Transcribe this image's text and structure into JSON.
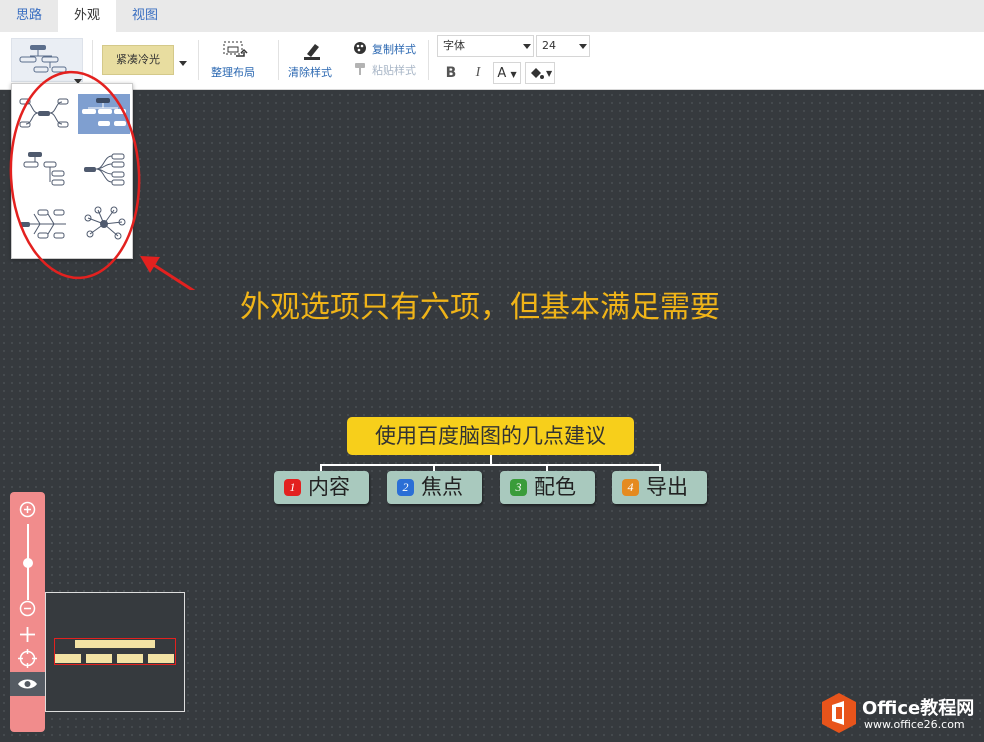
{
  "tabs": [
    {
      "label": "思路",
      "active": false
    },
    {
      "label": "外观",
      "active": true
    },
    {
      "label": "视图",
      "active": false
    }
  ],
  "toolbar": {
    "theme_label": "紧凑冷光",
    "arrange_label": "整理布局",
    "clear_style_label": "清除样式",
    "copy_style_label": "复制样式",
    "paste_style_label": "粘贴样式",
    "font_select": "字体",
    "size_select": "24",
    "bold": "B",
    "italic": "I",
    "font_color": "A",
    "bg_color_icon": "paint-bucket-icon"
  },
  "layout_options": [
    {
      "name": "mindmap",
      "selected": false
    },
    {
      "name": "org-chart",
      "selected": true
    },
    {
      "name": "tree-right",
      "selected": false
    },
    {
      "name": "fishbone-left",
      "selected": false
    },
    {
      "name": "fishbone",
      "selected": false
    },
    {
      "name": "network",
      "selected": false
    }
  ],
  "annotation": "外观选项只有六项，但基本满足需要",
  "mindmap": {
    "root": "使用百度脑图的几点建议",
    "children": [
      {
        "num": "1",
        "label": "内容",
        "color": "#e3211f"
      },
      {
        "num": "2",
        "label": "焦点",
        "color": "#2b6fd6"
      },
      {
        "num": "3",
        "label": "配色",
        "color": "#3a9c3a"
      },
      {
        "num": "4",
        "label": "导出",
        "color": "#e58a1f"
      }
    ]
  },
  "watermark": {
    "brand": "Office教程网",
    "url": "www.office26.com"
  },
  "colors": {
    "accent_link": "#2a67b1",
    "root_fill": "#f7cf1b",
    "child_fill": "#a9c9be",
    "annotation": "#f0b418",
    "zoom_panel": "#f18c8c",
    "highlight_circle": "#e3211f"
  }
}
